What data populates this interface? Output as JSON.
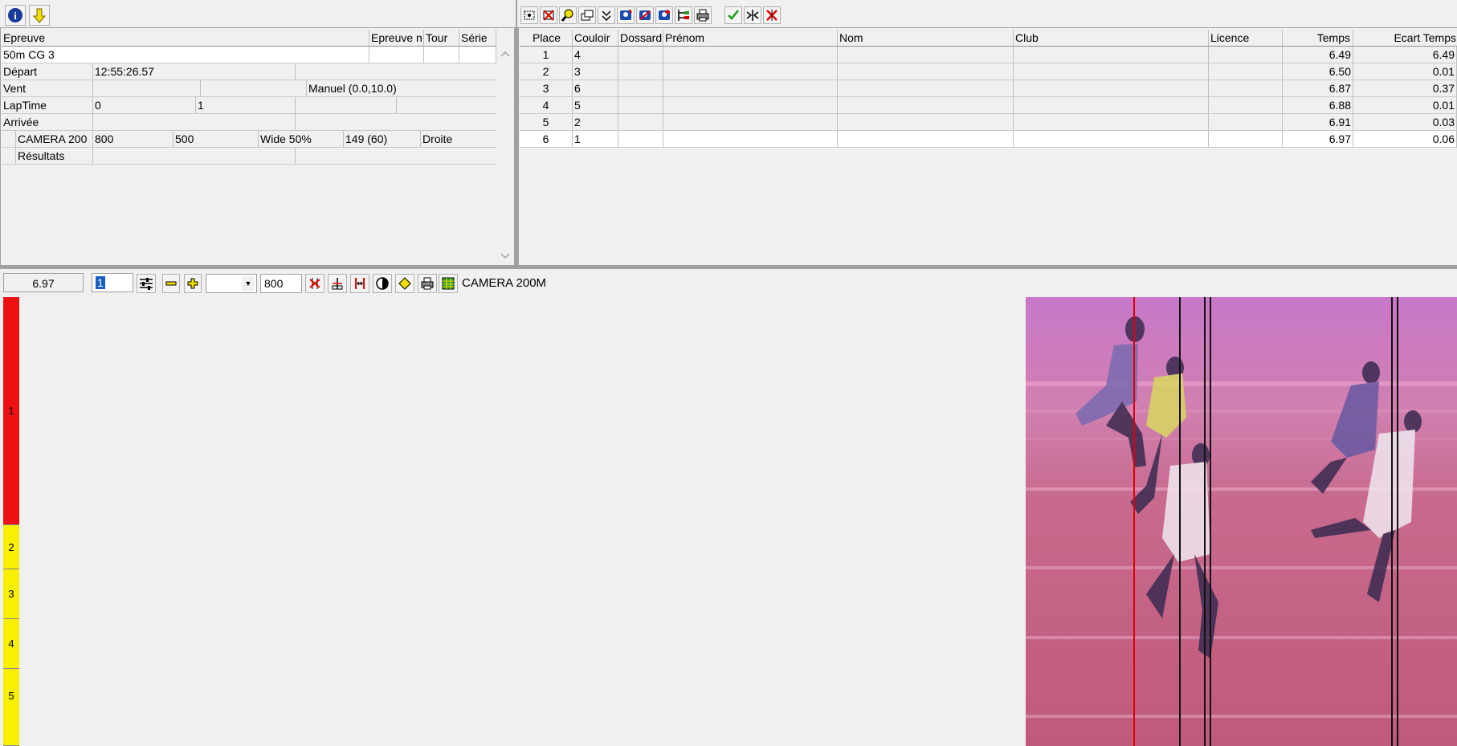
{
  "left_panel": {
    "headers": {
      "epreuve": "Epreuve",
      "epreuve_n": "Epreuve n",
      "tour": "Tour",
      "serie": "Série"
    },
    "event_name": "50m CG 3",
    "rows": {
      "depart_label": "Départ",
      "depart_value": "12:55:26.57",
      "vent_label": "Vent",
      "vent_value": "Manuel (0.0,10.0)",
      "laptime_label": "LapTime",
      "laptime_v1": "0",
      "laptime_v2": "1",
      "arrivee_label": "Arrivée",
      "camera_name": "CAMERA 200",
      "camera_v1": "800",
      "camera_v2": "500",
      "camera_wide": "Wide 50%",
      "camera_v3": "149  (60)",
      "camera_side": "Droite",
      "resultats_label": "Résultats"
    }
  },
  "results": {
    "columns": [
      "Place",
      "Couloir",
      "Dossard",
      "Prénom",
      "Nom",
      "Club",
      "Licence",
      "Temps",
      "Ecart Temps"
    ],
    "rows": [
      {
        "place": "1",
        "couloir": "4",
        "temps": "6.49",
        "ecart": "6.49"
      },
      {
        "place": "2",
        "couloir": "3",
        "temps": "6.50",
        "ecart": "0.01"
      },
      {
        "place": "3",
        "couloir": "6",
        "temps": "6.87",
        "ecart": "0.37"
      },
      {
        "place": "4",
        "couloir": "5",
        "temps": "6.88",
        "ecart": "0.01"
      },
      {
        "place": "5",
        "couloir": "2",
        "temps": "6.91",
        "ecart": "0.03"
      },
      {
        "place": "6",
        "couloir": "1",
        "temps": "6.97",
        "ecart": "0.06"
      }
    ]
  },
  "image_toolbar": {
    "time_value": "6.97",
    "spin_value": "1",
    "zoom_value": "800",
    "camera_label": "CAMERA 200M"
  },
  "lanes": [
    "1",
    "2",
    "3",
    "4",
    "5"
  ],
  "colors": {
    "lane_active": "#ee1111",
    "lane_inactive": "#f8f000",
    "photo_base": "#c8608a"
  }
}
